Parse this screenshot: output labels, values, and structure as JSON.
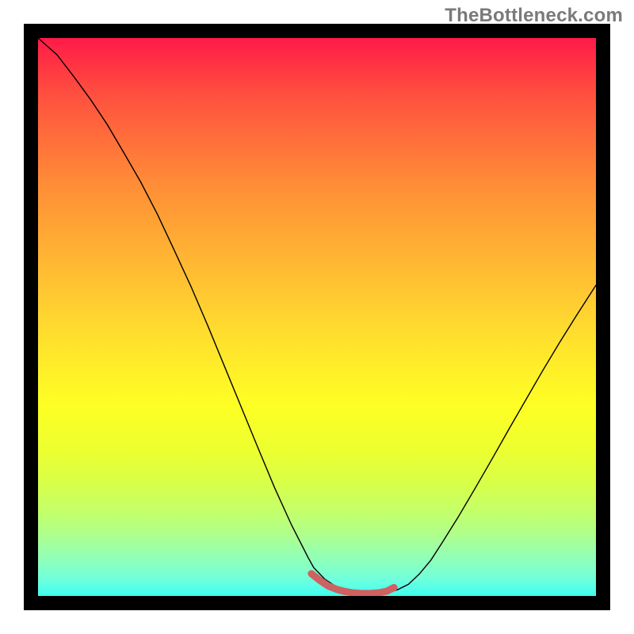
{
  "watermark": "TheBottleneck.com",
  "chart_data": {
    "type": "line",
    "title": "",
    "xlabel": "",
    "ylabel": "",
    "xlim": [
      0,
      100
    ],
    "ylim": [
      0,
      100
    ],
    "series": [
      {
        "name": "bottleneck-curve",
        "color": "#000000",
        "width": 1.4,
        "x": [
          0,
          3.4,
          6.4,
          9.4,
          12.4,
          15.4,
          18.4,
          21.4,
          24.4,
          27.4,
          30.4,
          33.4,
          36.4,
          39.4,
          42.4,
          45.4,
          48.4,
          49.4,
          51.4,
          53.4,
          56.4,
          58.4,
          61,
          62.8,
          64.4,
          66.4,
          68.4,
          70.4,
          72.4,
          75.4,
          78.4,
          81.4,
          84.4,
          87.4,
          90.4,
          93.4,
          96.4,
          100
        ],
        "y": [
          100,
          97.0,
          93.1,
          89.0,
          84.5,
          79.4,
          74.2,
          68.4,
          62.0,
          55.5,
          48.5,
          41.2,
          33.9,
          26.6,
          19.4,
          12.8,
          6.9,
          5.1,
          3.0,
          1.7,
          0.8,
          0.5,
          0.4,
          0.6,
          1.1,
          2.1,
          4.0,
          6.4,
          9.5,
          14.3,
          19.4,
          24.6,
          29.9,
          35.1,
          40.3,
          45.3,
          50.1,
          55.7
        ]
      },
      {
        "name": "sweet-spot-marker",
        "color": "#CF6161",
        "width": 9,
        "x": [
          49.0,
          50.5,
          52.0,
          53.5,
          55.0,
          56.5,
          58.0,
          59.5,
          61.0,
          62.5,
          63.8
        ],
        "y": [
          4.0,
          2.8,
          1.8,
          1.2,
          0.8,
          0.55,
          0.45,
          0.45,
          0.55,
          0.85,
          1.5
        ]
      }
    ]
  },
  "colors": {
    "frame": "#000000",
    "curve": "#000000",
    "marker": "#CF6161"
  }
}
